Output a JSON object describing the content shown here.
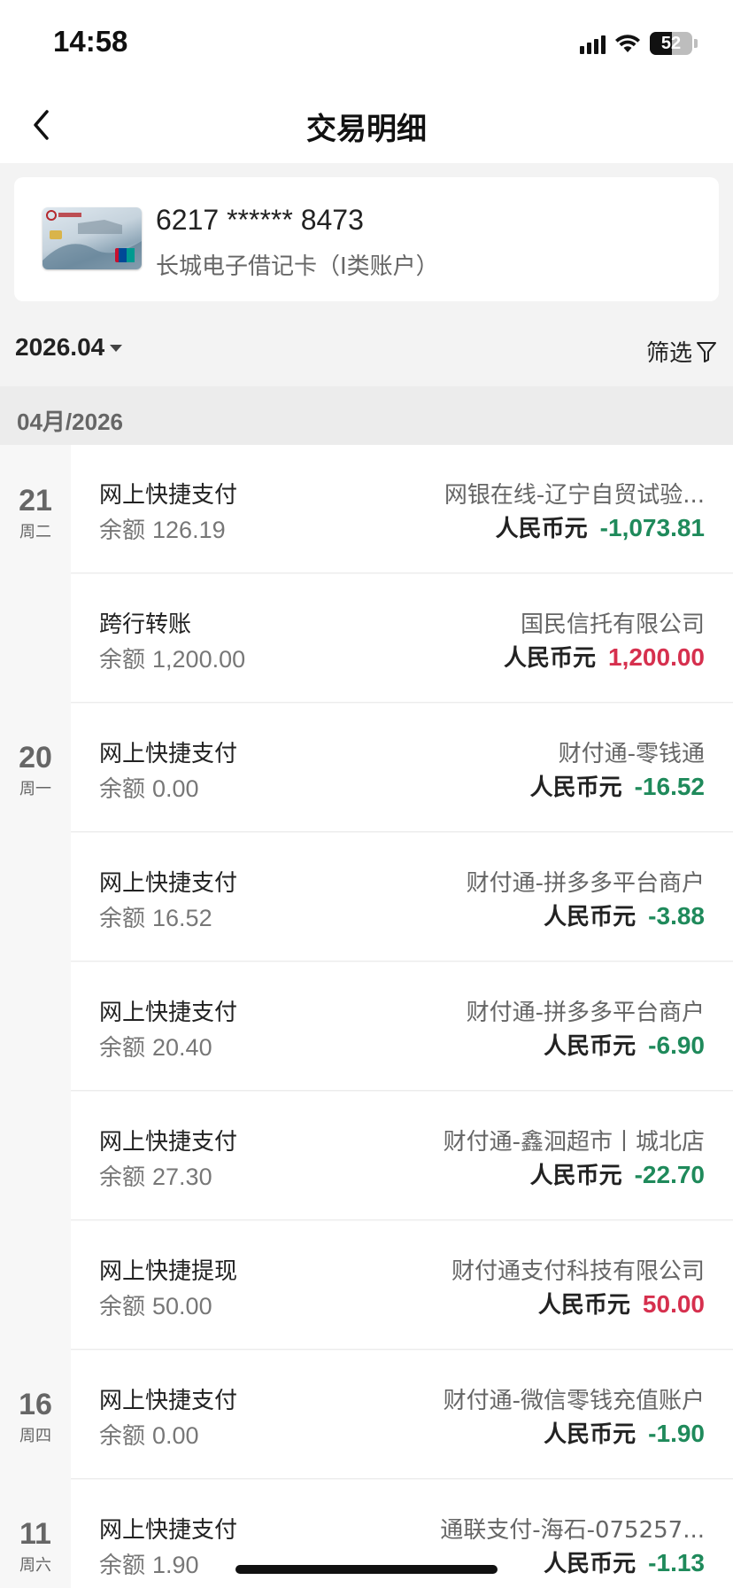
{
  "status_bar": {
    "time": "14:58",
    "battery": "52",
    "battery_level": 0.52
  },
  "nav": {
    "title": "交易明细"
  },
  "card": {
    "number": "6217 ****** 8473",
    "name": "长城电子借记卡（I类账户）"
  },
  "filter_bar": {
    "month": "2026.04",
    "filter_label": "筛选"
  },
  "section": {
    "title": "04月/2026"
  },
  "days": [
    {
      "day": "21",
      "weekday": "周二"
    },
    {
      "day": "20",
      "weekday": "周一"
    },
    {
      "day": "16",
      "weekday": "周四"
    },
    {
      "day": "11",
      "weekday": "周六"
    }
  ],
  "transactions": [
    {
      "type": "网上快捷支付",
      "balance_label": "余额",
      "balance": "126.19",
      "merchant": "网银在线-辽宁自贸试验...",
      "currency": "人民币元",
      "amount": "-1,073.81",
      "direction": "out"
    },
    {
      "type": "跨行转账",
      "balance_label": "余额",
      "balance": "1,200.00",
      "merchant": "国民信托有限公司",
      "currency": "人民币元",
      "amount": "1,200.00",
      "direction": "in"
    },
    {
      "type": "网上快捷支付",
      "balance_label": "余额",
      "balance": "0.00",
      "merchant": "财付通-零钱通",
      "currency": "人民币元",
      "amount": "-16.52",
      "direction": "out"
    },
    {
      "type": "网上快捷支付",
      "balance_label": "余额",
      "balance": "16.52",
      "merchant": "财付通-拼多多平台商户",
      "currency": "人民币元",
      "amount": "-3.88",
      "direction": "out"
    },
    {
      "type": "网上快捷支付",
      "balance_label": "余额",
      "balance": "20.40",
      "merchant": "财付通-拼多多平台商户",
      "currency": "人民币元",
      "amount": "-6.90",
      "direction": "out"
    },
    {
      "type": "网上快捷支付",
      "balance_label": "余额",
      "balance": "27.30",
      "merchant": "财付通-鑫洄超市丨城北店",
      "currency": "人民币元",
      "amount": "-22.70",
      "direction": "out"
    },
    {
      "type": "网上快捷提现",
      "balance_label": "余额",
      "balance": "50.00",
      "merchant": "财付通支付科技有限公司",
      "currency": "人民币元",
      "amount": "50.00",
      "direction": "in"
    },
    {
      "type": "网上快捷支付",
      "balance_label": "余额",
      "balance": "0.00",
      "merchant": "财付通-微信零钱充值账户",
      "currency": "人民币元",
      "amount": "-1.90",
      "direction": "out"
    },
    {
      "type": "网上快捷支付",
      "balance_label": "余额",
      "balance": "1.90",
      "merchant": "通联支付-海石-075257...",
      "currency": "人民币元",
      "amount": "-1.13",
      "direction": "out"
    }
  ],
  "colors": {
    "debit": "#1f8a5b",
    "credit": "#d6304e",
    "background": "#f3f3f3"
  }
}
